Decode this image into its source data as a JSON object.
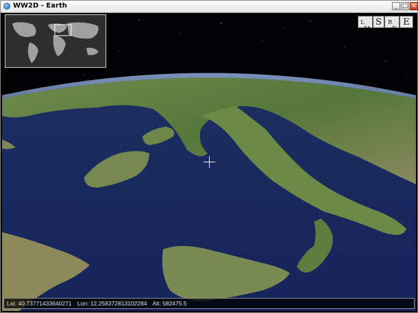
{
  "window": {
    "title": "WW2D - Earth"
  },
  "controls": {
    "minimize": "_",
    "maximize": "□",
    "close": "×"
  },
  "compass_buttons": {
    "lm": {
      "sup": "L",
      "sub": "M"
    },
    "s": "S",
    "rf": {
      "sup": "R",
      "sub": "F"
    },
    "e": "E"
  },
  "status": {
    "lat": "Lat: 40.73771433640271",
    "lon": "Lon: 12.258372813102284",
    "alt": "Alt: 582475.5"
  },
  "icons": [
    "globe-app-icon",
    "crosshair-icon",
    "minimize-icon",
    "maximize-icon",
    "close-icon"
  ]
}
